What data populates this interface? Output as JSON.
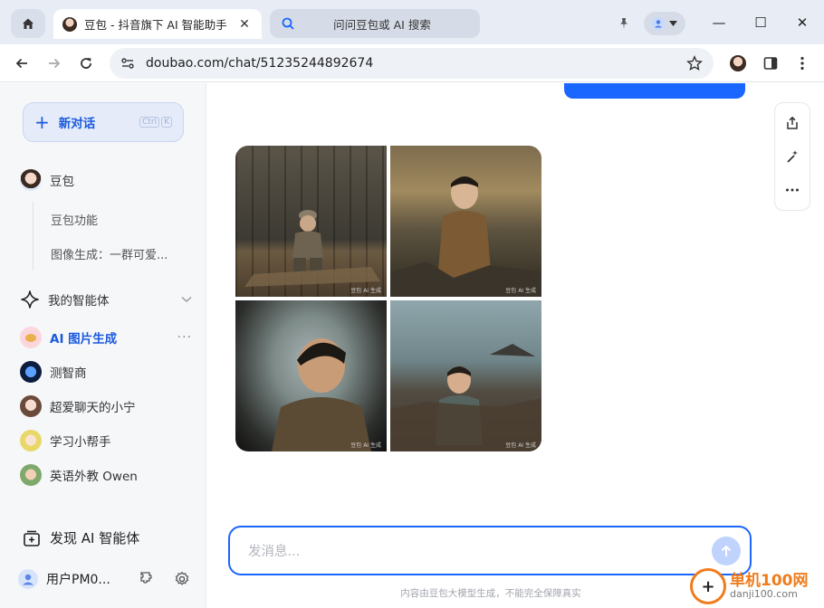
{
  "browser": {
    "tab_title": "豆包 - 抖音旗下 AI 智能助手",
    "tab_close": "✕",
    "search_tab_label": "问问豆包或 AI 搜索",
    "url": "doubao.com/chat/51235244892674",
    "minimize": "—",
    "maximize": "☐",
    "close": "✕"
  },
  "sidebar": {
    "new_chat": {
      "label": "新对话",
      "shortcut_1": "Ctrl",
      "shortcut_2": "K"
    },
    "doubao": {
      "label": "豆包",
      "sub_items": [
        "豆包功能",
        "图像生成：一群可爱..."
      ]
    },
    "agents_title": "我的智能体",
    "agents": [
      {
        "label": "AI 图片生成",
        "active": true,
        "more": "···"
      },
      {
        "label": "测智商"
      },
      {
        "label": "超爱聊天的小宁"
      },
      {
        "label": "学习小帮手"
      },
      {
        "label": "英语外教 Owen"
      }
    ],
    "discover": "发现 AI 智能体",
    "user": "用户PM0..."
  },
  "main": {
    "image_watermark": "豆包 AI 生成",
    "composer_placeholder": "发消息...",
    "disclaimer": "内容由豆包大模型生成，不能完全保障真实"
  },
  "site_watermark": {
    "name": "单机100网",
    "url": "danji100.com",
    "logo_glyph": "+"
  },
  "colors": {
    "accent": "#1a66ff",
    "sidebar_bg": "#f6f7f9",
    "tabstrip_bg": "#e8edf5"
  }
}
